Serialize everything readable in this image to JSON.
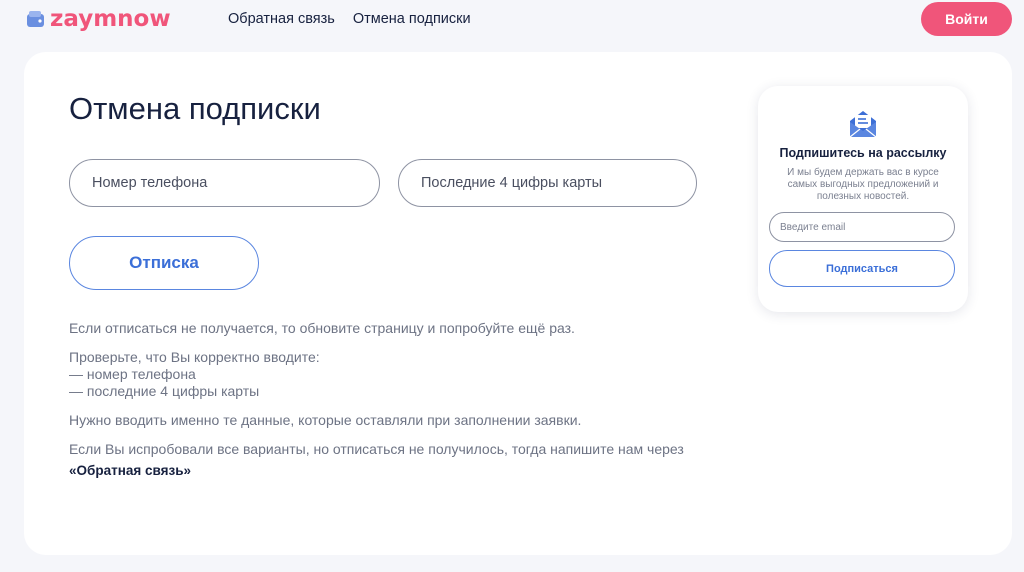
{
  "colors": {
    "brand": "#f0557a",
    "accent": "#3b6fd8",
    "text": "#17213f",
    "muted": "#6d7384",
    "background": "#f5f6fa"
  },
  "header": {
    "logo_text": "zaymnow",
    "logo_icon": "wallet-icon",
    "nav": [
      "Обратная связь",
      "Отмена подписки"
    ],
    "login_label": "Войти"
  },
  "main": {
    "title": "Отмена подписки",
    "phone_placeholder": "Номер телефона",
    "card_placeholder": "Последние 4 цифры карты",
    "unsubscribe_label": "Отписка",
    "info": {
      "p1": "Если отписаться не получается, то обновите страницу и попробуйте ещё раз.",
      "p2": "Проверьте, что Вы корректно вводите:\n— номер телефона\n— последние 4 цифры карты",
      "p3": "Нужно вводить именно те данные, которые оставляли при заполнении заявки.",
      "p4": "Если Вы испробовали все варианты, но отписаться не получилось, тогда напишите нам через",
      "link": "«Обратная связь»"
    }
  },
  "subscribe": {
    "icon": "mail-envelope-icon",
    "title": "Подпишитесь на рассылку",
    "description": "И мы будем держать вас в курсе самых выгодных предложений и полезных новостей.",
    "email_placeholder": "Введите email",
    "button_label": "Подписаться"
  }
}
